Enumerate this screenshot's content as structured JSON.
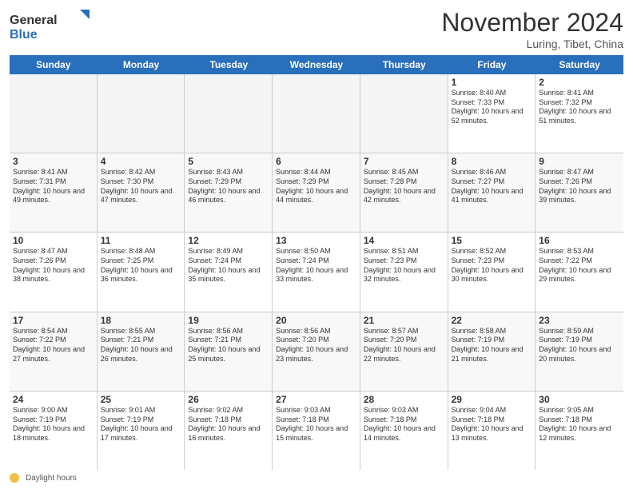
{
  "logo": {
    "general": "General",
    "blue": "Blue"
  },
  "header": {
    "month": "November 2024",
    "location": "Luring, Tibet, China"
  },
  "weekdays": [
    "Sunday",
    "Monday",
    "Tuesday",
    "Wednesday",
    "Thursday",
    "Friday",
    "Saturday"
  ],
  "footer": {
    "label": "Daylight hours"
  },
  "rows": [
    {
      "cells": [
        {
          "day": "",
          "info": ""
        },
        {
          "day": "",
          "info": ""
        },
        {
          "day": "",
          "info": ""
        },
        {
          "day": "",
          "info": ""
        },
        {
          "day": "",
          "info": ""
        },
        {
          "day": "1",
          "info": "Sunrise: 8:40 AM\nSunset: 7:33 PM\nDaylight: 10 hours and 52 minutes."
        },
        {
          "day": "2",
          "info": "Sunrise: 8:41 AM\nSunset: 7:32 PM\nDaylight: 10 hours and 51 minutes."
        }
      ]
    },
    {
      "cells": [
        {
          "day": "3",
          "info": "Sunrise: 8:41 AM\nSunset: 7:31 PM\nDaylight: 10 hours and 49 minutes."
        },
        {
          "day": "4",
          "info": "Sunrise: 8:42 AM\nSunset: 7:30 PM\nDaylight: 10 hours and 47 minutes."
        },
        {
          "day": "5",
          "info": "Sunrise: 8:43 AM\nSunset: 7:29 PM\nDaylight: 10 hours and 46 minutes."
        },
        {
          "day": "6",
          "info": "Sunrise: 8:44 AM\nSunset: 7:29 PM\nDaylight: 10 hours and 44 minutes."
        },
        {
          "day": "7",
          "info": "Sunrise: 8:45 AM\nSunset: 7:28 PM\nDaylight: 10 hours and 42 minutes."
        },
        {
          "day": "8",
          "info": "Sunrise: 8:46 AM\nSunset: 7:27 PM\nDaylight: 10 hours and 41 minutes."
        },
        {
          "day": "9",
          "info": "Sunrise: 8:47 AM\nSunset: 7:26 PM\nDaylight: 10 hours and 39 minutes."
        }
      ]
    },
    {
      "cells": [
        {
          "day": "10",
          "info": "Sunrise: 8:47 AM\nSunset: 7:26 PM\nDaylight: 10 hours and 38 minutes."
        },
        {
          "day": "11",
          "info": "Sunrise: 8:48 AM\nSunset: 7:25 PM\nDaylight: 10 hours and 36 minutes."
        },
        {
          "day": "12",
          "info": "Sunrise: 8:49 AM\nSunset: 7:24 PM\nDaylight: 10 hours and 35 minutes."
        },
        {
          "day": "13",
          "info": "Sunrise: 8:50 AM\nSunset: 7:24 PM\nDaylight: 10 hours and 33 minutes."
        },
        {
          "day": "14",
          "info": "Sunrise: 8:51 AM\nSunset: 7:23 PM\nDaylight: 10 hours and 32 minutes."
        },
        {
          "day": "15",
          "info": "Sunrise: 8:52 AM\nSunset: 7:23 PM\nDaylight: 10 hours and 30 minutes."
        },
        {
          "day": "16",
          "info": "Sunrise: 8:53 AM\nSunset: 7:22 PM\nDaylight: 10 hours and 29 minutes."
        }
      ]
    },
    {
      "cells": [
        {
          "day": "17",
          "info": "Sunrise: 8:54 AM\nSunset: 7:22 PM\nDaylight: 10 hours and 27 minutes."
        },
        {
          "day": "18",
          "info": "Sunrise: 8:55 AM\nSunset: 7:21 PM\nDaylight: 10 hours and 26 minutes."
        },
        {
          "day": "19",
          "info": "Sunrise: 8:56 AM\nSunset: 7:21 PM\nDaylight: 10 hours and 25 minutes."
        },
        {
          "day": "20",
          "info": "Sunrise: 8:56 AM\nSunset: 7:20 PM\nDaylight: 10 hours and 23 minutes."
        },
        {
          "day": "21",
          "info": "Sunrise: 8:57 AM\nSunset: 7:20 PM\nDaylight: 10 hours and 22 minutes."
        },
        {
          "day": "22",
          "info": "Sunrise: 8:58 AM\nSunset: 7:19 PM\nDaylight: 10 hours and 21 minutes."
        },
        {
          "day": "23",
          "info": "Sunrise: 8:59 AM\nSunset: 7:19 PM\nDaylight: 10 hours and 20 minutes."
        }
      ]
    },
    {
      "cells": [
        {
          "day": "24",
          "info": "Sunrise: 9:00 AM\nSunset: 7:19 PM\nDaylight: 10 hours and 18 minutes."
        },
        {
          "day": "25",
          "info": "Sunrise: 9:01 AM\nSunset: 7:19 PM\nDaylight: 10 hours and 17 minutes."
        },
        {
          "day": "26",
          "info": "Sunrise: 9:02 AM\nSunset: 7:18 PM\nDaylight: 10 hours and 16 minutes."
        },
        {
          "day": "27",
          "info": "Sunrise: 9:03 AM\nSunset: 7:18 PM\nDaylight: 10 hours and 15 minutes."
        },
        {
          "day": "28",
          "info": "Sunrise: 9:03 AM\nSunset: 7:18 PM\nDaylight: 10 hours and 14 minutes."
        },
        {
          "day": "29",
          "info": "Sunrise: 9:04 AM\nSunset: 7:18 PM\nDaylight: 10 hours and 13 minutes."
        },
        {
          "day": "30",
          "info": "Sunrise: 9:05 AM\nSunset: 7:18 PM\nDaylight: 10 hours and 12 minutes."
        }
      ]
    }
  ]
}
